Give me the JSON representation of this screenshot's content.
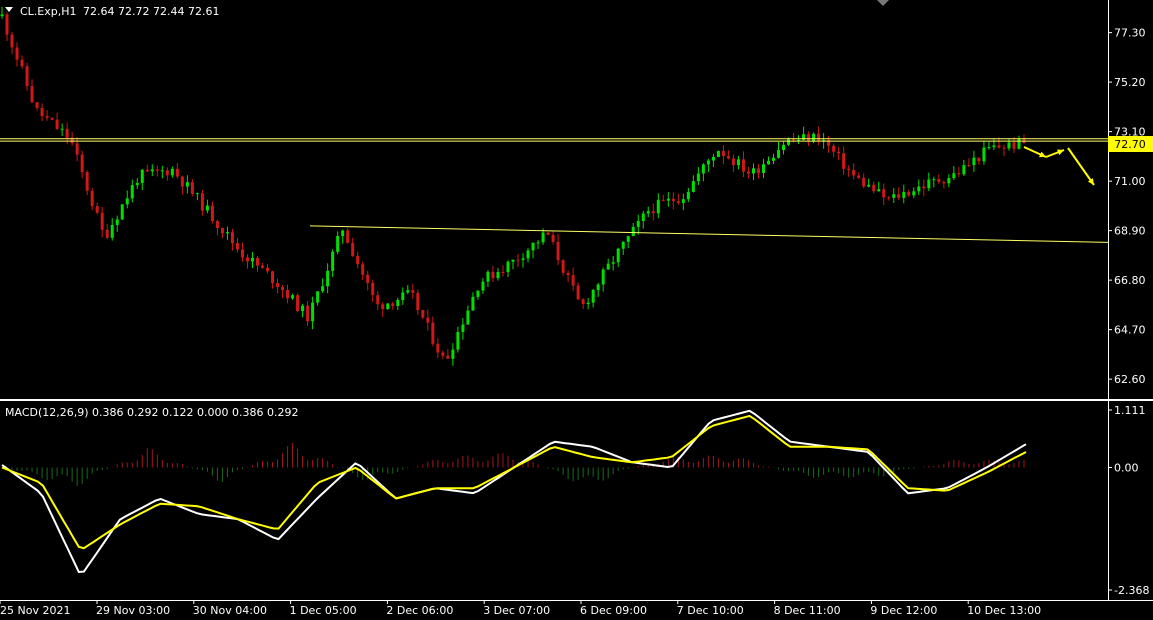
{
  "header": {
    "symbol": "CL.Exp,H1",
    "ohlc": "72.64 72.72 72.44 72.61",
    "menu_icon": "triangle-down-icon"
  },
  "current_price_label": "72.70",
  "colors": {
    "background": "#000000",
    "bull_candle": "#00e000",
    "bear_candle": "#d01818",
    "level_line": "#ffff66",
    "macd_line": "#ffffff",
    "signal_line": "#ffff00",
    "hist_up": "#a01818",
    "hist_down": "#1a6a1a",
    "arrow": "#ffff00"
  },
  "macd": {
    "label": "MACD(12,26,9) 0.386 0.292 0.122 0.000 0.386 0.292"
  },
  "chart_data": [
    {
      "type": "candlestick",
      "title": "CL.Exp,H1",
      "ylim": [
        61.8,
        78.6
      ],
      "y_ticks": [
        "77.30",
        "75.20",
        "73.10",
        "71.00",
        "68.90",
        "66.80",
        "64.70",
        "62.60"
      ],
      "x_ticks": [
        "25 Nov 2021",
        "29 Nov 03:00",
        "30 Nov 04:00",
        "1 Dec 05:00",
        "2 Dec 06:00",
        "3 Dec 07:00",
        "6 Dec 09:00",
        "7 Dec 10:00",
        "8 Dec 11:00",
        "9 Dec 12:00",
        "10 Dec 13:00"
      ],
      "horizontal_levels": [
        72.8,
        72.7
      ],
      "trendline": [
        {
          "x": "1 Dec 05:00",
          "y": 69.1
        },
        {
          "x": "10 Dec 13:00 +",
          "y": 68.4
        }
      ],
      "last_close": 72.61,
      "close_path_keypoints": [
        {
          "x": "25 Nov 2021",
          "y": 78.0
        },
        {
          "x": "25 Nov 2021 +12h",
          "y": 74.0
        },
        {
          "x": "26 Nov",
          "y": 72.8
        },
        {
          "x": "26 Nov +4h",
          "y": 68.6
        },
        {
          "x": "29 Nov 03:00",
          "y": 71.2
        },
        {
          "x": "29 Nov 12:00",
          "y": 71.5
        },
        {
          "x": "30 Nov 00:00",
          "y": 69.8
        },
        {
          "x": "30 Nov 04:00",
          "y": 68.0
        },
        {
          "x": "30 Nov 12:00",
          "y": 66.8
        },
        {
          "x": "30 Nov 18:00",
          "y": 65.2
        },
        {
          "x": "1 Dec 05:00",
          "y": 69.0
        },
        {
          "x": "1 Dec 12:00",
          "y": 65.7
        },
        {
          "x": "1 Dec 20:00",
          "y": 66.2
        },
        {
          "x": "2 Dec 06:00",
          "y": 63.3
        },
        {
          "x": "2 Dec 12:00",
          "y": 66.7
        },
        {
          "x": "2 Dec 20:00",
          "y": 67.6
        },
        {
          "x": "3 Dec 07:00",
          "y": 68.8
        },
        {
          "x": "3 Dec 12:00",
          "y": 65.6
        },
        {
          "x": "3 Dec 18:00",
          "y": 67.8
        },
        {
          "x": "6 Dec 09:00",
          "y": 69.8
        },
        {
          "x": "6 Dec 20:00",
          "y": 70.4
        },
        {
          "x": "7 Dec 10:00",
          "y": 72.4
        },
        {
          "x": "7 Dec 20:00",
          "y": 71.3
        },
        {
          "x": "8 Dec 11:00",
          "y": 72.7
        },
        {
          "x": "8 Dec 18:00",
          "y": 72.9
        },
        {
          "x": "9 Dec 06:00",
          "y": 71.2
        },
        {
          "x": "9 Dec 12:00",
          "y": 70.2
        },
        {
          "x": "9 Dec 18:00",
          "y": 70.8
        },
        {
          "x": "10 Dec 06:00",
          "y": 71.3
        },
        {
          "x": "10 Dec 13:00",
          "y": 72.4
        },
        {
          "x": "10 Dec 20:00",
          "y": 72.61
        }
      ]
    },
    {
      "type": "macd",
      "title": "MACD(12,26,9)",
      "ylim": [
        -2.368,
        1.111
      ],
      "y_ticks": [
        "1.111",
        "0.00",
        "-2.368"
      ],
      "values_shown": {
        "macd": 0.386,
        "signal": 0.292,
        "histogram": 0.122
      },
      "macd_keypoints": [
        0.05,
        -0.5,
        -2.1,
        -1.0,
        -0.6,
        -0.9,
        -1.0,
        -1.4,
        -0.6,
        0.1,
        -0.6,
        -0.4,
        -0.5,
        0.0,
        0.5,
        0.4,
        0.1,
        0.0,
        0.9,
        1.1,
        0.5,
        0.4,
        0.3,
        -0.5,
        -0.4,
        0.0,
        0.45
      ],
      "signal_keypoints": [
        0.0,
        -0.3,
        -1.6,
        -1.1,
        -0.7,
        -0.75,
        -1.0,
        -1.2,
        -0.3,
        0.0,
        -0.6,
        -0.4,
        -0.4,
        0.0,
        0.4,
        0.2,
        0.1,
        0.2,
        0.8,
        1.0,
        0.4,
        0.4,
        0.35,
        -0.4,
        -0.45,
        -0.1,
        0.3
      ],
      "histogram_direction_keypoints": [
        0.0,
        -0.4,
        0.4,
        -0.3,
        0.5,
        -0.3,
        0.2,
        0.3,
        -0.4,
        0.2,
        0.25,
        -0.2,
        -0.2,
        0.15,
        0.15
      ]
    }
  ]
}
